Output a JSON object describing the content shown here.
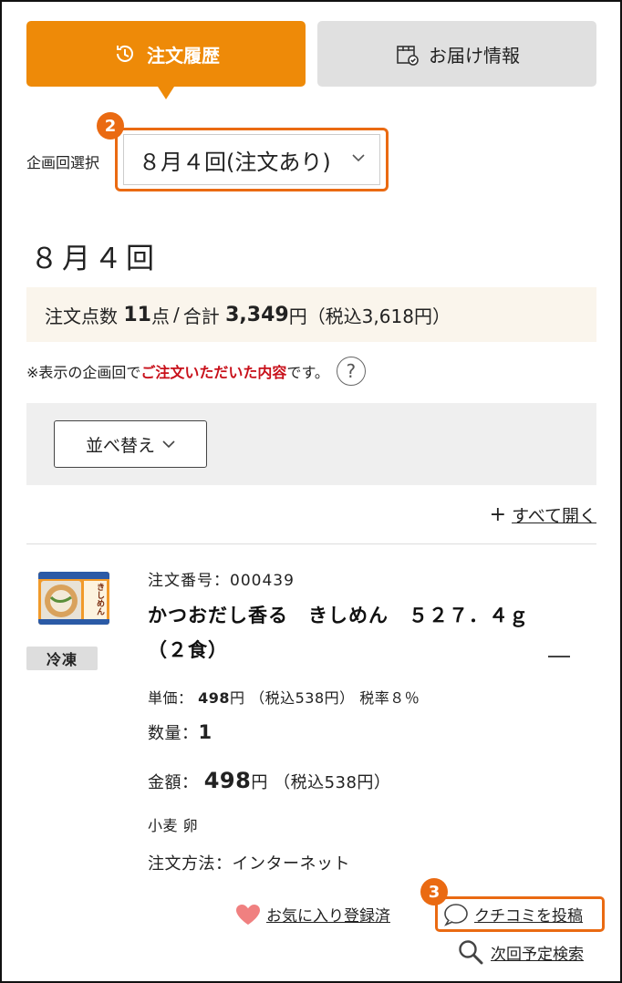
{
  "tabs": {
    "history_label": "注文履歴",
    "delivery_label": "お届け情報"
  },
  "badges": {
    "select": "2",
    "review": "3"
  },
  "plan": {
    "label": "企画回選択",
    "selected": "８月４回(注文あり)"
  },
  "section_title": "８月４回",
  "summary": {
    "count_label": "注文点数",
    "count_value": "11",
    "count_unit": "点",
    "separator": "/",
    "total_label": "合計",
    "total_value": "3,349",
    "total_unit": "円",
    "tax_included": "（税込3,618円）"
  },
  "note": {
    "prefix": "※表示の企画回で",
    "highlight": "ご注文いただいた内容",
    "suffix": "です。",
    "help": "?"
  },
  "sort_label": "並べ替え",
  "expand_all": {
    "plus": "+",
    "label": "すべて開く"
  },
  "item": {
    "storage": "冷凍",
    "order_no": "注文番号：000439",
    "name": "かつおだし香る　きしめん　５２７．４ｇ（２食）",
    "unit_price_label": "単価：",
    "unit_price_value": "498",
    "unit_price_unit": "円",
    "unit_price_tax": "（税込538円）",
    "tax_rate": "税率８％",
    "qty_label": "数量：",
    "qty_value": "1",
    "amount_label": "金額：",
    "amount_value": "498",
    "amount_unit": "円",
    "amount_tax": "（税込538円）",
    "allergens": "小麦 卵",
    "method": "注文方法：インターネット",
    "thumb_text": "きしめん",
    "favorite_label": "お気に入り登録済",
    "review_label": "クチコミを投稿",
    "next_search_label": "次回予定検索"
  },
  "colors": {
    "accent": "#ee8a08",
    "badge": "#ea6a12",
    "highlight_text": "#c8101a",
    "heart": "#f08080"
  }
}
